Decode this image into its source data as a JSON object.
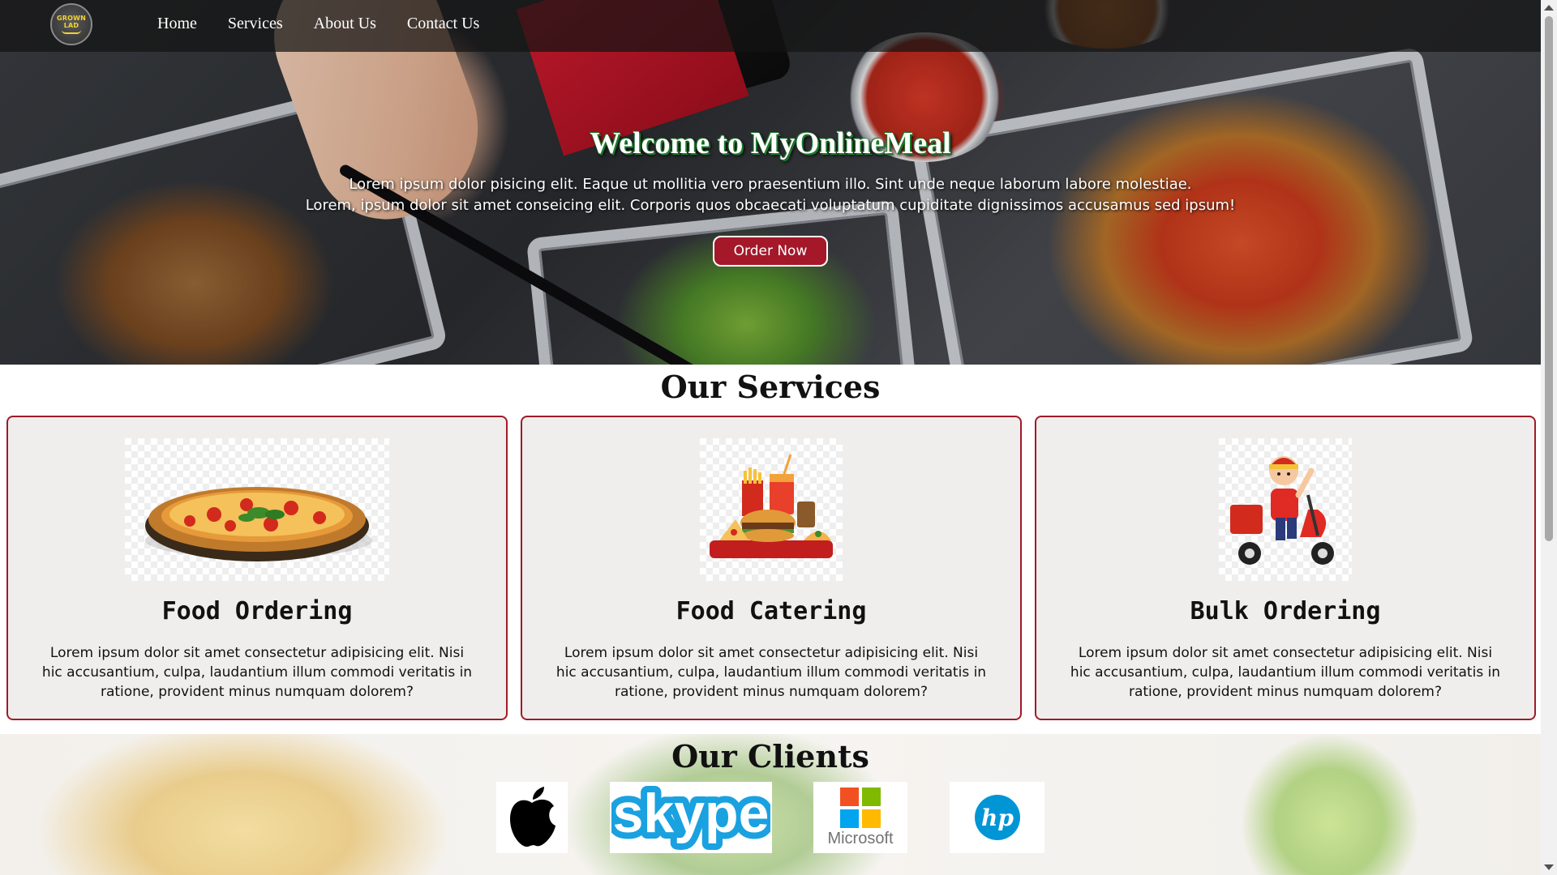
{
  "nav": {
    "logo_text_line1": "GROWN",
    "logo_text_line2": "LAD",
    "links": [
      "Home",
      "Services",
      "About Us",
      "Contact Us"
    ]
  },
  "hero": {
    "title": "Welcome to MyOnlineMeal",
    "line1": "Lorem ipsum dolor pisicing elit. Eaque ut mollitia vero praesentium illo. Sint unde neque laborum labore molestiae.",
    "line2": "Lorem, ipsum dolor sit amet conseicing elit. Corporis quos obcaecati voluptatum cupiditate dignissimos accusamus sed ipsum!",
    "button": "Order Now"
  },
  "services": {
    "title": "Our Services",
    "items": [
      {
        "name": "Food Ordering",
        "text": "Lorem ipsum dolor sit amet consectetur adipisicing elit. Nisi hic accusantium, culpa, laudantium illum commodi veritatis in ratione, provident minus numquam dolorem?"
      },
      {
        "name": "Food Catering",
        "text": "Lorem ipsum dolor sit amet consectetur adipisicing elit. Nisi hic accusantium, culpa, laudantium illum commodi veritatis in ratione, provident minus numquam dolorem?"
      },
      {
        "name": "Bulk Ordering",
        "text": "Lorem ipsum dolor sit amet consectetur adipisicing elit. Nisi hic accusantium, culpa, laudantium illum commodi veritatis in ratione, provident minus numquam dolorem?"
      }
    ]
  },
  "clients": {
    "title": "Our Clients",
    "logos": [
      "apple",
      "skype",
      "Microsoft",
      "hp"
    ]
  },
  "colors": {
    "accent": "#a4182a",
    "card_border": "#a01a28",
    "card_bg": "#f0eeed",
    "nav_bg": "#141414"
  }
}
